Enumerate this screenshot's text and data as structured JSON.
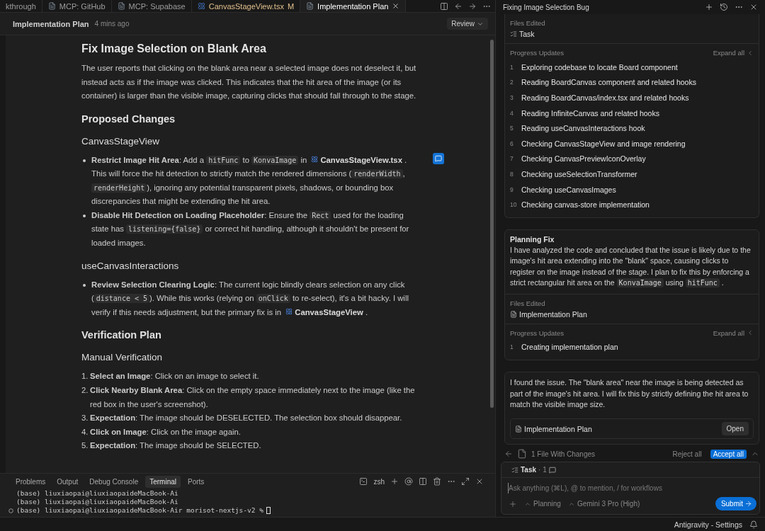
{
  "tabs": [
    {
      "label": "kthrough",
      "kind": "plain",
      "selected": false
    },
    {
      "label": "MCP: GitHub",
      "kind": "doc",
      "selected": false
    },
    {
      "label": "MCP: Supabase",
      "kind": "doc",
      "selected": false
    },
    {
      "label": "CanvasStageView.tsx",
      "kind": "react",
      "selected": false,
      "badge": "M"
    },
    {
      "label": "Implementation Plan",
      "kind": "doc",
      "selected": true
    }
  ],
  "doc_header": {
    "title": "Implementation Plan",
    "time": "4 mins ago",
    "button": "Review"
  },
  "document": [
    {
      "kind": "h1",
      "segments": [
        {
          "kind": "text",
          "text": "Fix Image Selection on Blank Area"
        }
      ]
    },
    {
      "kind": "p",
      "segments": [
        {
          "kind": "text",
          "text": "The user reports that clicking on the blank area near a selected image does not deselect it, but instead acts as if the image was clicked. This indicates that the hit area of the image (or its container) is larger than the visible image, capturing clicks that should fall through to the stage."
        }
      ]
    },
    {
      "kind": "h2",
      "segments": [
        {
          "kind": "text",
          "text": "Proposed Changes"
        }
      ]
    },
    {
      "kind": "h3",
      "segments": [
        {
          "kind": "text",
          "text": "CanvasStageView"
        }
      ]
    },
    {
      "kind": "ul",
      "items": [
        {
          "comment": true,
          "segments": [
            {
              "kind": "text",
              "text": "**Restrict Image Hit Area**: Add a "
            },
            {
              "kind": "code",
              "text": "hitFunc"
            },
            {
              "kind": "text",
              "text": " to "
            },
            {
              "kind": "code",
              "text": "KonvaImage"
            },
            {
              "kind": "text",
              "text": " in "
            },
            {
              "kind": "file",
              "text": "CanvasStageView.tsx"
            },
            {
              "kind": "text",
              "text": " . This will force the hit detection to strictly match the rendered dimensions ("
            },
            {
              "kind": "code",
              "text": "renderWidth"
            },
            {
              "kind": "text",
              "text": ", "
            },
            {
              "kind": "code",
              "text": "renderHeight"
            },
            {
              "kind": "text",
              "text": "), ignoring any potential transparent pixels, shadows, or bounding box discrepancies that might be extending the hit area."
            }
          ]
        },
        {
          "comment": false,
          "segments": [
            {
              "kind": "text",
              "text": "**Disable Hit Detection on Loading Placeholder**: Ensure the "
            },
            {
              "kind": "code",
              "text": "Rect"
            },
            {
              "kind": "text",
              "text": " used for the loading state has "
            },
            {
              "kind": "code",
              "text": "listening={false}"
            },
            {
              "kind": "text",
              "text": " or correct hit handling, although it shouldn't be present for loaded images."
            }
          ]
        }
      ]
    },
    {
      "kind": "h3",
      "segments": [
        {
          "kind": "text",
          "text": "useCanvasInteractions"
        }
      ]
    },
    {
      "kind": "ul",
      "items": [
        {
          "comment": false,
          "segments": [
            {
              "kind": "text",
              "text": "**Review Selection Clearing Logic**: The current logic blindly clears selection on any click ("
            },
            {
              "kind": "code",
              "text": "distance < 5"
            },
            {
              "kind": "text",
              "text": "). While this works (relying on "
            },
            {
              "kind": "code",
              "text": "onClick"
            },
            {
              "kind": "text",
              "text": " to re-select), it's a bit hacky. I will verify if this needs adjustment, but the primary fix is in "
            },
            {
              "kind": "file",
              "text": "CanvasStageView"
            },
            {
              "kind": "text",
              "text": " ."
            }
          ]
        }
      ]
    },
    {
      "kind": "h2",
      "segments": [
        {
          "kind": "text",
          "text": "Verification Plan"
        }
      ]
    },
    {
      "kind": "h3",
      "segments": [
        {
          "kind": "text",
          "text": "Manual Verification"
        }
      ]
    },
    {
      "kind": "ol",
      "items": [
        {
          "number": "1.",
          "comment": false,
          "segments": [
            {
              "kind": "text",
              "text": "**Select an Image**: Click on an image to select it."
            }
          ]
        },
        {
          "number": "2.",
          "comment": false,
          "segments": [
            {
              "kind": "text",
              "text": "**Click Nearby Blank Area**: Click on the empty space immediately next to the image (like the red box in the user's screenshot)."
            }
          ]
        },
        {
          "number": "3.",
          "comment": false,
          "segments": [
            {
              "kind": "text",
              "text": "**Expectation**: The image should be DESELECTED. The selection box should disappear."
            }
          ]
        },
        {
          "number": "4.",
          "comment": false,
          "segments": [
            {
              "kind": "text",
              "text": "**Click on Image**: Click on the image again."
            }
          ]
        },
        {
          "number": "5.",
          "comment": false,
          "segments": [
            {
              "kind": "text",
              "text": "**Expectation**: The image should be SELECTED."
            }
          ]
        }
      ]
    }
  ],
  "terminal": {
    "tabs": [
      {
        "label": "Problems",
        "selected": false
      },
      {
        "label": "Output",
        "selected": false
      },
      {
        "label": "Debug Console",
        "selected": false
      },
      {
        "label": "Terminal",
        "selected": true
      },
      {
        "label": "Ports",
        "selected": false
      }
    ],
    "shell": "zsh",
    "lines": [
      {
        "text": "(base) liuxiaopai@liuxiaopaideMacBook-Ai",
        "current": false
      },
      {
        "text": "(base) liuxiaopai@liuxiaopaideMacBook-Ai",
        "current": false
      },
      {
        "text": "(base) liuxiaopai@liuxiaopaideMacBook-Air morisot-nextjs-v2 %",
        "current": true
      }
    ]
  },
  "agent": {
    "title": "Fixing Image Selection Bug",
    "cards": [
      {
        "cut": true,
        "files_label": "Files Edited",
        "files": [
          {
            "name": "Task",
            "kind": "task"
          }
        ],
        "progress_label": "Progress Updates",
        "expand": "Expand all",
        "steps": [
          {
            "n": "1",
            "text": "Exploring codebase to locate Board component"
          },
          {
            "n": "2",
            "text": "Reading BoardCanvas component and related hooks"
          },
          {
            "n": "3",
            "text": "Reading BoardCanvas/index.tsx and related hooks"
          },
          {
            "n": "4",
            "text": "Reading InfiniteCanvas and related hooks"
          },
          {
            "n": "5",
            "text": "Reading useCanvasInteractions hook"
          },
          {
            "n": "6",
            "text": "Checking CanvasStageView and image rendering"
          },
          {
            "n": "7",
            "text": "Checking CanvasPreviewIconOverlay"
          },
          {
            "n": "8",
            "text": "Checking useSelectionTransformer"
          },
          {
            "n": "9",
            "text": "Checking useCanvasImages"
          },
          {
            "n": "10",
            "text": "Checking canvas-store implementation"
          }
        ]
      },
      {
        "cut": false,
        "title": "Planning Fix",
        "body": [
          {
            "kind": "text",
            "text": "I have analyzed the code and concluded that the issue is likely due to the image's hit area extending into the \"blank\" space, causing clicks to register on the image instead of the stage. I plan to fix this by enforcing a strict rectangular hit area on the "
          },
          {
            "kind": "code",
            "text": "KonvaImage"
          },
          {
            "kind": "text",
            "text": " using "
          },
          {
            "kind": "code",
            "text": "hitFunc"
          },
          {
            "kind": "text",
            "text": " ."
          }
        ],
        "files_label": "Files Edited",
        "files": [
          {
            "name": "Implementation Plan",
            "kind": "doc"
          }
        ],
        "progress_label": "Progress Updates",
        "expand": "Expand all",
        "steps": [
          {
            "n": "1",
            "text": "Creating implementation plan"
          }
        ]
      }
    ],
    "message": {
      "text": "I found the issue. The \"blank area\" near the image is being detected as part of the image's hit area. I will fix this by strictly defining the hit area to match the visible image size.",
      "artifact": "Implementation Plan",
      "open": "Open"
    },
    "changes": {
      "label": "1 File With Changes",
      "reject": "Reject all",
      "accept": "Accept all"
    },
    "composer": {
      "task": "Task",
      "count": "· 1",
      "placeholder": "Ask anything (⌘L), @ to mention, / for workflows",
      "mode": "Planning",
      "model": "Gemini 3 Pro (High)",
      "submit": "Submit"
    }
  },
  "status_bar": {
    "text": "Antigravity - Settings"
  }
}
